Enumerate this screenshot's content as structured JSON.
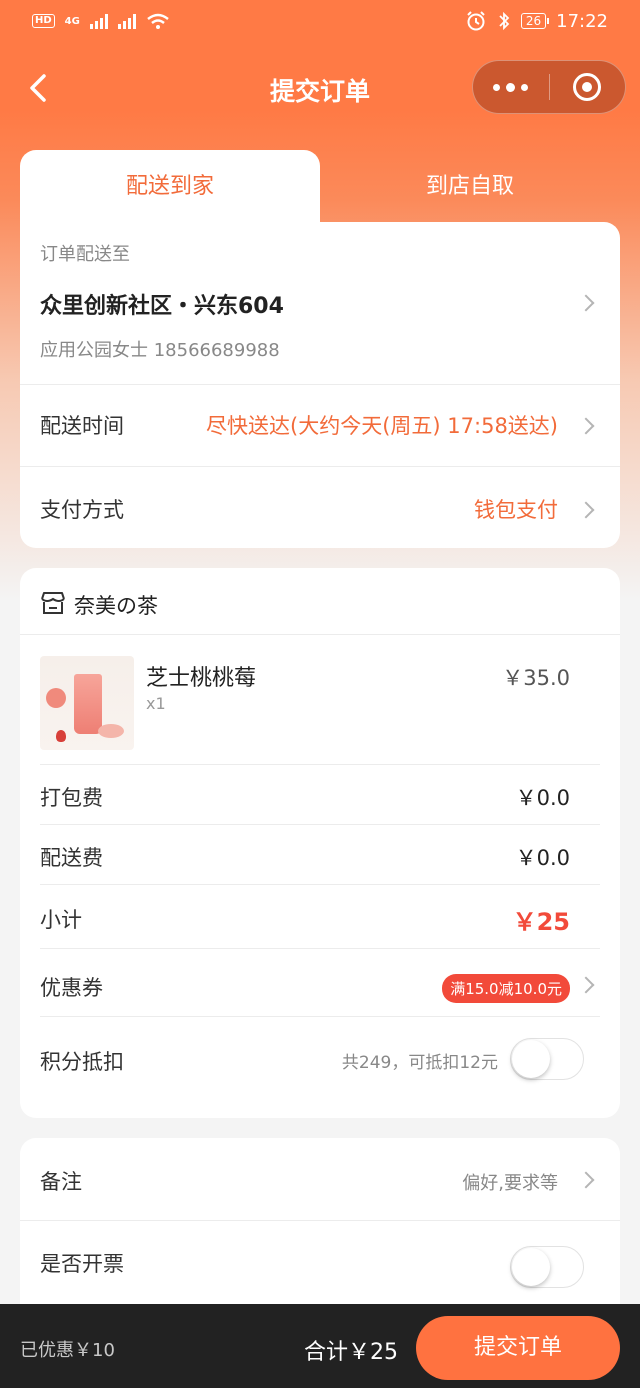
{
  "status_bar": {
    "network_badge": "HD",
    "network_type": "4G",
    "battery_level": "26",
    "time": "17:22"
  },
  "nav": {
    "title": "提交订单"
  },
  "delivery": {
    "tab_delivery": "配送到家",
    "tab_pickup": "到店自取",
    "address_caption": "订单配送至",
    "address_main": "众里创新社区・兴东604",
    "address_contact": "应用公园女士 18566689988",
    "time_label": "配送时间",
    "time_value": "尽快送达(大约今天(周五) 17:58送达)",
    "payment_label": "支付方式",
    "payment_value": "钱包支付"
  },
  "order": {
    "shop_name": "奈美の茶",
    "product_name": "芝士桃桃莓",
    "product_qty": "x1",
    "product_price": "￥35.0",
    "packing_label": "打包费",
    "packing_value": "￥0.0",
    "shipping_label": "配送费",
    "shipping_value": "￥0.0",
    "subtotal_label": "小计",
    "subtotal_value": "￥25",
    "coupon_label": "优惠券",
    "coupon_badge": "满15.0减10.0元",
    "points_label": "积分抵扣",
    "points_hint": "共249，可抵扣12元",
    "points_enabled": false
  },
  "extras": {
    "remark_label": "备注",
    "remark_hint": "偏好,要求等",
    "invoice_label": "是否开票",
    "invoice_enabled": false
  },
  "bottom": {
    "saved_text": "已优惠￥10",
    "total_text": "合计￥25",
    "submit_label": "提交订单"
  },
  "colors": {
    "brand_orange": "#ff7240",
    "accent_text": "#f26b3a",
    "price_red": "#f24a3a",
    "bottom_bar": "#222222"
  }
}
